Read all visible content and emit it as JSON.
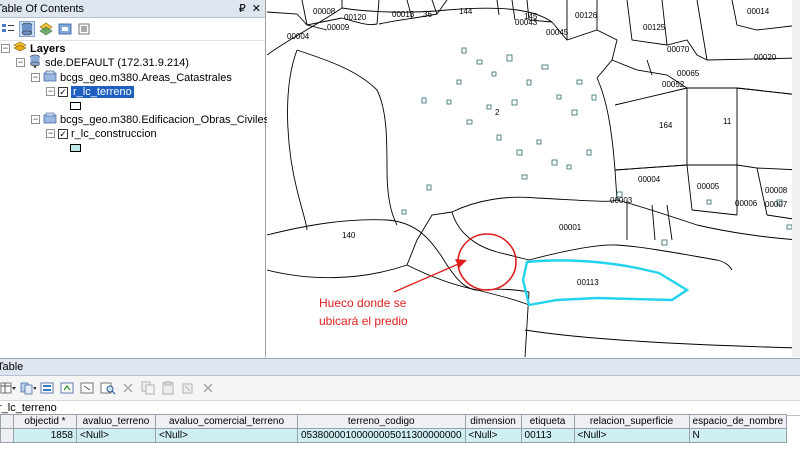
{
  "toc": {
    "title": "Table Of Contents",
    "pin_glyph": "₽",
    "close_glyph": "✕",
    "layers_label": "Layers",
    "db_label": "sde.DEFAULT (172.31.9.214)",
    "group1_label": "bcgs_geo.m380.Areas_Catastrales",
    "layer1_label": "r_lc_terreno",
    "group2_label": "bcgs_geo.m380.Edificacion_Obras_Civiles",
    "layer2_label": "r_lc_construccion",
    "swatch2_color": "#bfe8ea",
    "expander": "−",
    "checkmark": "✓"
  },
  "map": {
    "parcel_labels": [
      "00008",
      "00009",
      "00120",
      "00013",
      "36",
      "144",
      "145",
      "00043",
      "00126",
      "00014",
      "00020",
      "00004",
      "00045",
      "00125",
      "00070",
      "00065",
      "00052",
      "2",
      "164",
      "11",
      "00004",
      "00003",
      "00005",
      "00006",
      "00008",
      "00007",
      "00001",
      "140",
      "00113"
    ],
    "annotation_line1": "Hueco donde se",
    "annotation_line2": "ubicará el predio",
    "annotation_color": "#e02020",
    "highlight_color": "#22d3ee"
  },
  "table": {
    "title": "Table",
    "layer_tab": "r_lc_terreno",
    "columns": [
      "objectid *",
      "avaluo_terreno",
      "avaluo_comercial_terreno",
      "terreno_codigo",
      "dimension",
      "etiqueta",
      "relacion_superficie",
      "espacio_de_nombre"
    ],
    "row": [
      "1858",
      "<Null>",
      "<Null>",
      "05380000100000005011300000000",
      "<Null>",
      "00113",
      "<Null>",
      "N"
    ]
  }
}
